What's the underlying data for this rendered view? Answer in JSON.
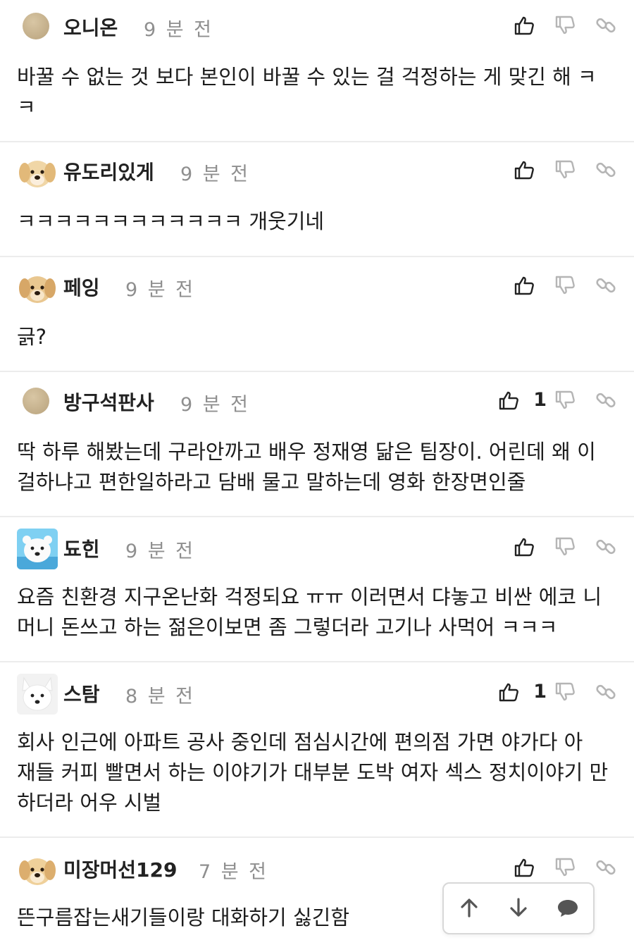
{
  "comments": [
    {
      "nick": "오니온",
      "time": "9 분 전",
      "likes": "",
      "text": "바꿀 수 없는 것 보다 본인이 바꿀 수 있는 걸 걱정하는 게 맞긴 해 ㅋ ㅋ",
      "avatar": "avatar-dot"
    },
    {
      "nick": "유도리있게",
      "time": "9 분 전",
      "likes": "",
      "text": "ㅋㅋㅋㅋㅋㅋㅋㅋㅋㅋㅋㅋ 개웃기네",
      "avatar": "puppy-avatar"
    },
    {
      "nick": "페잉",
      "time": "9 분 전",
      "likes": "",
      "text": "긁?",
      "avatar": "puppy-avatar"
    },
    {
      "nick": "방구석판사",
      "time": "9 분 전",
      "likes": "1",
      "text": "딱 하루 해봤는데 구라안까고 배우 정재영 닮은 팀장이. 어린데 왜 이 걸하냐고 편한일하라고 담배 물고 말하는데 영화 한장면인줄",
      "avatar": "avatar-dot"
    },
    {
      "nick": "됴힌",
      "time": "9 분 전",
      "likes": "",
      "text": "요즘 친환경 지구온난화 걱정되요 ㅠㅠ 이러면서 댜놓고 비싼 에코 니 머니 돈쓰고 하는 젊은이보면 좀 그렇더라 고기나 사먹어 ㅋㅋㅋ",
      "avatar": "polar-bear-avatar"
    },
    {
      "nick": "스탐",
      "time": "8 분 전",
      "likes": "1",
      "text": "회사 인근에 아파트 공사 중인데 점심시간에 편의점 가면 야가다 아 재들 커피 빨면서 하는 이야기가 대부분 도박 여자 섹스 정치이야기 만 하더라 어우 시벌",
      "avatar": "white-dog-avatar"
    },
    {
      "nick": "미장머선129",
      "time": "7 분 전",
      "likes": "",
      "text": "뜬구름잡는새기들이랑 대화하기 싫긴함",
      "avatar": "puppy-avatar"
    }
  ],
  "icons": {
    "thumbs_up": "thumbs-up-icon",
    "thumbs_down": "thumbs-down-icon",
    "link": "link-icon",
    "scroll_up": "arrow-up-icon",
    "scroll_down": "arrow-down-icon",
    "chat": "chat-bubble-icon"
  },
  "colors": {
    "text": "#1c1c1c",
    "time": "#8f8f8f",
    "icon_dark": "#222222",
    "icon_light": "#b5b5b5",
    "divider": "#ececec"
  }
}
